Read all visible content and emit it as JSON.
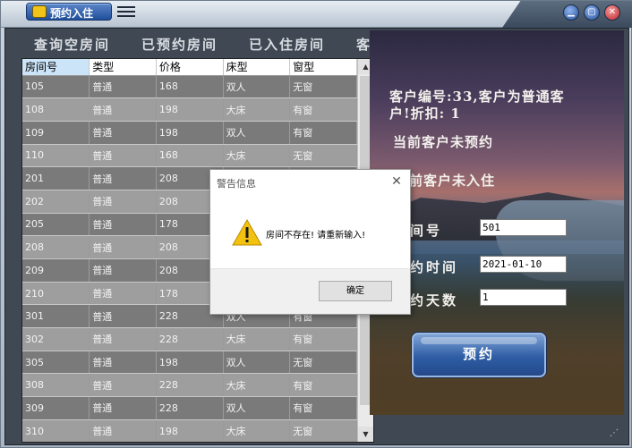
{
  "titlebar": {
    "app_label": "预约入住"
  },
  "nav": [
    "查询空房间",
    "已预约房间",
    "已入住房间",
    "客户充值"
  ],
  "table": {
    "headers": [
      "房间号",
      "类型",
      "价格",
      "床型",
      "窗型"
    ],
    "rows": [
      [
        "105",
        "普通",
        "168",
        "双人",
        "无窗"
      ],
      [
        "108",
        "普通",
        "198",
        "大床",
        "有窗"
      ],
      [
        "109",
        "普通",
        "198",
        "双人",
        "有窗"
      ],
      [
        "110",
        "普通",
        "168",
        "大床",
        "无窗"
      ],
      [
        "201",
        "普通",
        "208",
        "",
        ""
      ],
      [
        "202",
        "普通",
        "208",
        "",
        ""
      ],
      [
        "205",
        "普通",
        "178",
        "",
        ""
      ],
      [
        "208",
        "普通",
        "208",
        "",
        ""
      ],
      [
        "209",
        "普通",
        "208",
        "",
        ""
      ],
      [
        "210",
        "普通",
        "178",
        "",
        ""
      ],
      [
        "301",
        "普通",
        "228",
        "双人",
        "有窗"
      ],
      [
        "302",
        "普通",
        "228",
        "大床",
        "有窗"
      ],
      [
        "305",
        "普通",
        "198",
        "双人",
        "无窗"
      ],
      [
        "308",
        "普通",
        "228",
        "大床",
        "有窗"
      ],
      [
        "309",
        "普通",
        "228",
        "双人",
        "有窗"
      ],
      [
        "310",
        "普通",
        "198",
        "大床",
        "无窗"
      ]
    ]
  },
  "info": {
    "customer_line": "客户编号:33,客户为普通客户!折扣: 1",
    "booking_status": "当前客户未预约",
    "checkin_status": "前客户未入住"
  },
  "form": {
    "room_label": "间号",
    "room_value": "501",
    "date_label": "约时间",
    "date_value": "2021-01-10",
    "days_label": "约天数",
    "days_value": "1",
    "submit_label": "预约"
  },
  "dialog": {
    "title": "警告信息",
    "message": "房间不存在! 请重新输入!",
    "ok_label": "确定"
  },
  "colors": {
    "accent": "#2e5da5",
    "panel": "#3f4853",
    "warning": "#f3c20f"
  }
}
